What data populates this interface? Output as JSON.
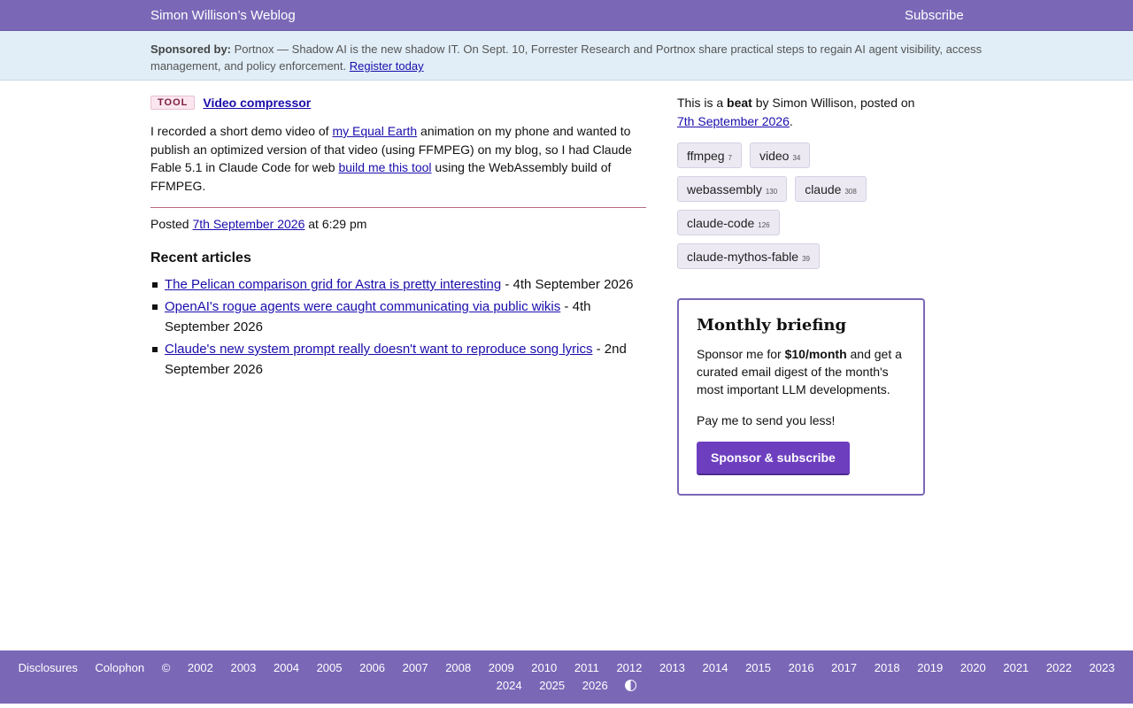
{
  "header": {
    "title": "Simon Willison’s Weblog",
    "subscribe": "Subscribe"
  },
  "sponsor": {
    "label": "Sponsored by:",
    "text": "Portnox — Shadow AI is the new shadow IT. On Sept. 10, Forrester Research and Portnox share practical steps to regain AI agent visibility, access management, and policy enforcement.",
    "link": "Register today"
  },
  "post": {
    "badge": "TOOL",
    "title": "Video compressor",
    "desc_1": "I recorded a short demo video of ",
    "link_1": "my Equal Earth",
    "desc_2": " animation on my phone and wanted to publish an optimized version of that video (using FFMPEG) on my blog, so I had Claude Fable 5.1 in Claude Code for web ",
    "link_2": "build me this tool",
    "desc_3": " using the WebAssembly build of FFMPEG.",
    "posted_prefix": "Posted ",
    "posted_date": "7th September 2026",
    "posted_time": " at 6:29 pm"
  },
  "recent": {
    "heading": "Recent articles",
    "items": [
      {
        "title": "The Pelican comparison grid for Astra is pretty interesting",
        "date": " - 4th September 2026"
      },
      {
        "title": "OpenAI's rogue agents were caught communicating via public wikis",
        "date": " - 4th September 2026"
      },
      {
        "title": "Claude's new system prompt really doesn't want to reproduce song lyrics",
        "date": " - 2nd September 2026"
      }
    ]
  },
  "sidebar": {
    "beat_1": "This is a ",
    "beat_bold": "beat",
    "beat_2": " by Simon Willison, posted on ",
    "beat_date": "7th September 2026",
    "beat_end": ".",
    "tags": [
      {
        "name": "ffmpeg",
        "count": "7"
      },
      {
        "name": "video",
        "count": "34"
      },
      {
        "name": "webassembly",
        "count": "130"
      },
      {
        "name": "claude",
        "count": "308"
      },
      {
        "name": "claude-code",
        "count": "126"
      },
      {
        "name": "claude-mythos-fable",
        "count": "39"
      }
    ]
  },
  "briefing": {
    "title": "Monthly briefing",
    "text_1": "Sponsor me for ",
    "price": "$10/month",
    "text_2": " and get a curated email digest of the month's most important LLM developments.",
    "pay": "Pay me to send you less!",
    "button": "Sponsor & subscribe"
  },
  "footer": {
    "disclosures": "Disclosures",
    "colophon": "Colophon",
    "copyright": "©",
    "years_row1": [
      "2002",
      "2003",
      "2004",
      "2005",
      "2006",
      "2007",
      "2008",
      "2009",
      "2010",
      "2011",
      "2012",
      "2013",
      "2014",
      "2015",
      "2016",
      "2017",
      "2018",
      "2019",
      "2020",
      "2021",
      "2022",
      "2023"
    ],
    "years_row2": [
      "2024",
      "2025",
      "2026"
    ]
  },
  "colors": {
    "brand": "#7a68b7",
    "sponsor_bg": "#e1eef7",
    "button": "#6d3fbf"
  }
}
